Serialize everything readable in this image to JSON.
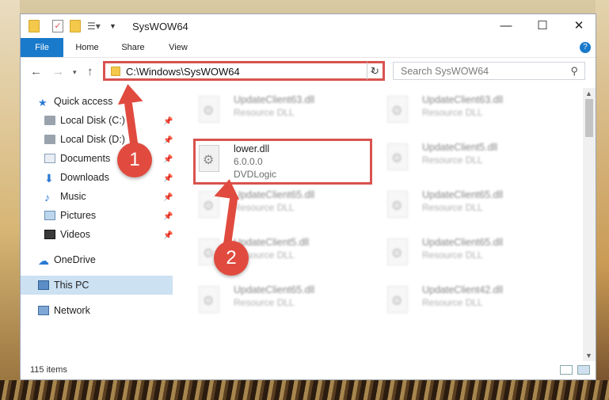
{
  "window": {
    "title": "SysWOW64"
  },
  "ribbon": {
    "tabs": [
      "File",
      "Home",
      "Share",
      "View"
    ],
    "help": "?"
  },
  "window_controls": {
    "minimize": "—",
    "maximize": "☐",
    "close": "✕"
  },
  "address_bar": {
    "path": "C:\\Windows\\SysWOW64"
  },
  "search": {
    "placeholder": "Search SysWOW64"
  },
  "sidebar": {
    "quick_access": "Quick access",
    "items": [
      {
        "label": "Local Disk (C:)",
        "pinned": true
      },
      {
        "label": "Local Disk (D:)",
        "pinned": true
      },
      {
        "label": "Documents",
        "pinned": true
      },
      {
        "label": "Downloads",
        "pinned": true
      },
      {
        "label": "Music",
        "pinned": true
      },
      {
        "label": "Pictures",
        "pinned": true
      },
      {
        "label": "Videos",
        "pinned": true
      }
    ],
    "onedrive": "OneDrive",
    "this_pc": "This PC",
    "network": "Network"
  },
  "files": {
    "left": [
      {
        "name": "UpdateClient63.dll",
        "type": "Resource DLL"
      },
      {
        "name": "lower.dll",
        "version": "6.0.0.0",
        "company": "DVDLogic"
      },
      {
        "name": "UpdateClient65.dll",
        "type": "Resource DLL"
      },
      {
        "name": "UpdateClient5.dll",
        "type": "Resource DLL"
      },
      {
        "name": "UpdateClient65.dll",
        "type": "Resource DLL"
      }
    ],
    "right": [
      {
        "name": "UpdateClient63.dll",
        "type": "Resource DLL"
      },
      {
        "name": "UpdateClient5.dll",
        "type": "Resource DLL"
      },
      {
        "name": "UpdateClient65.dll",
        "type": "Resource DLL"
      },
      {
        "name": "UpdateClient65.dll",
        "type": "Resource DLL"
      },
      {
        "name": "UpdateClient42.dll",
        "type": "Resource DLL"
      }
    ]
  },
  "status": {
    "items_count": "115 items"
  },
  "annotations": {
    "step1": "1",
    "step2": "2",
    "color": "#e14b3f"
  }
}
